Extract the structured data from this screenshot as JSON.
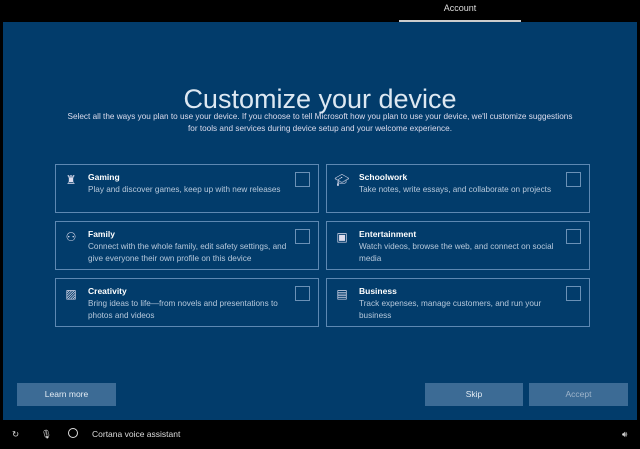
{
  "header": {
    "tab": "Account"
  },
  "main": {
    "title": "Customize your device",
    "description": "Select all the ways you plan to use your device. If you choose to tell Microsoft how you plan to use your device, we'll customize suggestions for tools and services during device setup and your welcome experience.",
    "options": [
      {
        "name": "Gaming",
        "text": "Play and discover games, keep up with new releases",
        "icon": "gaming-icon",
        "checked": false
      },
      {
        "name": "Schoolwork",
        "text": "Take notes, write essays, and collaborate on projects",
        "icon": "graduation-cap-icon",
        "checked": false
      },
      {
        "name": "Family",
        "text": "Connect with the whole family, edit safety settings, and give everyone their own profile on this device",
        "icon": "family-icon",
        "checked": false
      },
      {
        "name": "Entertainment",
        "text": "Watch videos, browse the web, and connect on social media",
        "icon": "entertainment-icon",
        "checked": false
      },
      {
        "name": "Creativity",
        "text": "Bring ideas to life—from novels and presentations to photos and videos",
        "icon": "picture-icon",
        "checked": false
      },
      {
        "name": "Business",
        "text": "Track expenses, manage customers, and run your business",
        "icon": "briefcase-icon",
        "checked": false
      }
    ]
  },
  "buttons": {
    "learn_more": "Learn more",
    "skip": "Skip",
    "accept": "Accept"
  },
  "taskbar": {
    "cortana": "Cortana voice assistant"
  }
}
